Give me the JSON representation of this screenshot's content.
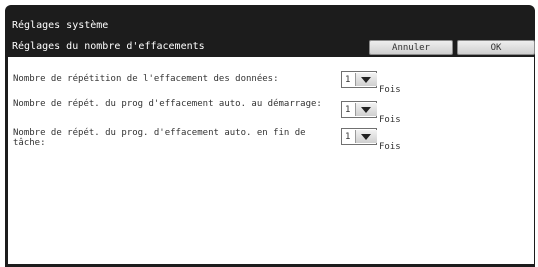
{
  "window": {
    "title": "Réglages système"
  },
  "subheader": {
    "title": "Réglages du nombre d'effacements"
  },
  "buttons": {
    "cancel": "Annuler",
    "ok": "OK"
  },
  "settings": [
    {
      "label": "Nombre de répétition de l'effacement des données:",
      "value": "1",
      "unit": "Fois"
    },
    {
      "label": "Nombre de répét. du prog d'effacement auto. au démarrage:",
      "value": "1",
      "unit": "Fois"
    },
    {
      "label": "Nombre de répét. du prog. d'effacement auto. en fin de tâche:",
      "value": "1",
      "unit": "Fois"
    }
  ]
}
